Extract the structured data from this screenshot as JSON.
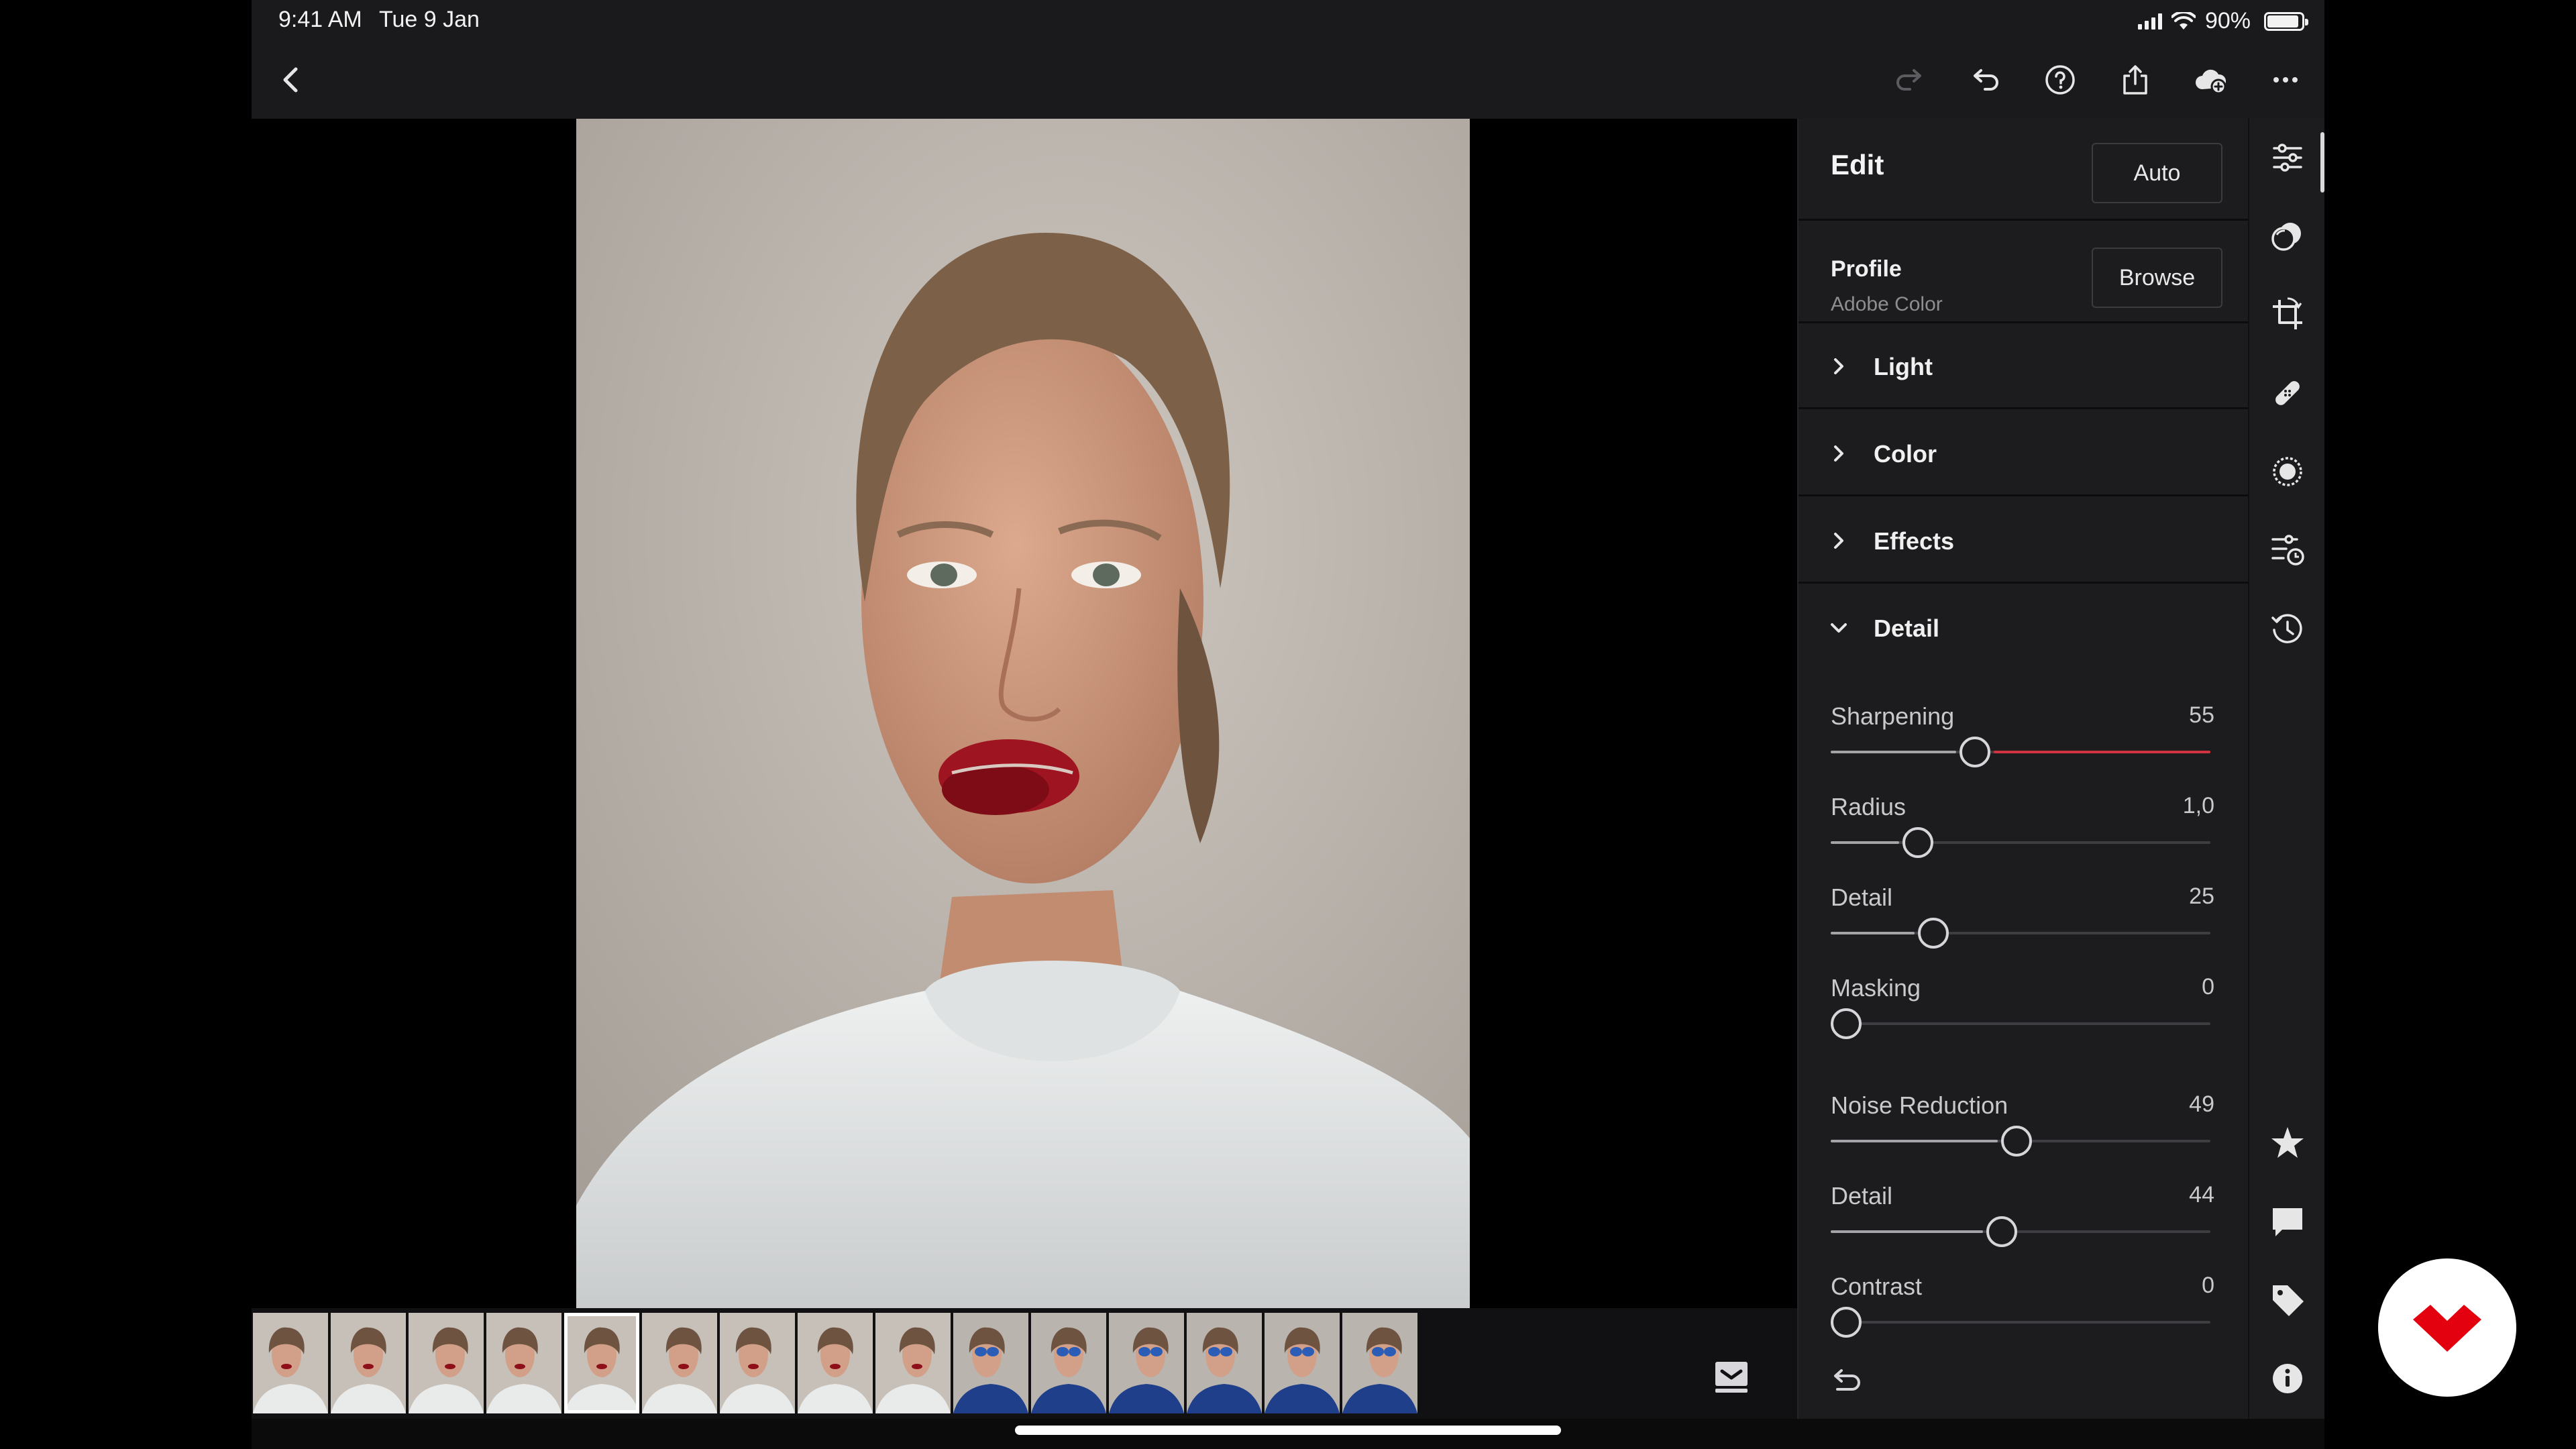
{
  "status_bar": {
    "time": "9:41 AM",
    "date": "Tue 9 Jan",
    "battery": "90%",
    "battery_level": 0.9,
    "icons": [
      "signal-icon",
      "wifi-icon",
      "battery-icon"
    ]
  },
  "toolbar": {
    "icons": [
      "back-icon",
      "redo-icon",
      "undo-icon",
      "help-icon",
      "share-icon",
      "cloud-sync-icon",
      "more-icon"
    ]
  },
  "edit_panel": {
    "title": "Edit",
    "auto_label": "Auto",
    "profile": {
      "label": "Profile",
      "value": "Adobe Color",
      "browse_label": "Browse"
    },
    "sections": [
      {
        "label": "Light",
        "expanded": false
      },
      {
        "label": "Color",
        "expanded": false
      },
      {
        "label": "Effects",
        "expanded": false
      },
      {
        "label": "Detail",
        "expanded": true
      }
    ],
    "detail": {
      "sliders": [
        {
          "label": "Sharpening",
          "value": "55",
          "position": 0.38,
          "accent": "#d13440"
        },
        {
          "label": "Radius",
          "value": "1,0",
          "position": 0.23
        },
        {
          "label": "Detail",
          "value": "25",
          "position": 0.27
        },
        {
          "label": "Masking",
          "value": "0",
          "position": 0.04
        },
        {
          "label": "Noise Reduction",
          "value": "49",
          "position": 0.49
        },
        {
          "label": "Detail",
          "value": "44",
          "position": 0.45
        },
        {
          "label": "Contrast",
          "value": "0",
          "position": 0.04
        }
      ]
    }
  },
  "right_rail": {
    "icons": [
      "sliders-icon",
      "presets-icon",
      "crop-icon",
      "healing-icon",
      "selective-icon",
      "versions-icon",
      "history-icon",
      "star-icon",
      "comment-icon",
      "tag-icon",
      "info-icon"
    ]
  },
  "filmstrip": {
    "count": 15,
    "selected_index": 4,
    "toggle_icon": "filmstrip-toggle-icon"
  },
  "colors": {
    "accent": "#d13440",
    "badge_logo": "#e3000f"
  }
}
